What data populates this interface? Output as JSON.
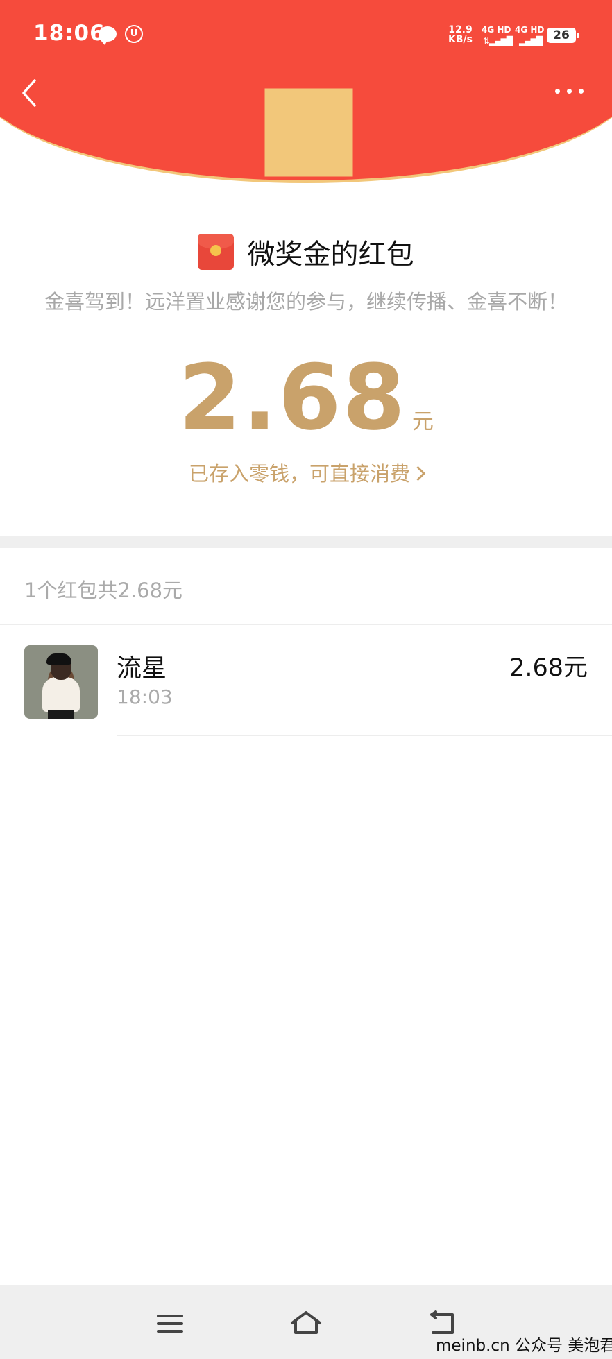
{
  "status_bar": {
    "time": "18:06",
    "speed_value": "12.9",
    "speed_unit": "KB/s",
    "network_1": "4G HD",
    "network_2": "4G HD",
    "battery": "26"
  },
  "header": {
    "back_icon": "chevron-left-icon",
    "more_icon": "more-dots-icon",
    "accent_color": "#f64b3c",
    "border_color": "#f2c77a"
  },
  "packet": {
    "icon": "red-envelope-icon",
    "title": "微奖金的红包",
    "blessing": "金喜驾到！远洋置业感谢您的参与，继续传播、金喜不断！",
    "amount": "2.68",
    "unit": "元",
    "deposit_text": "已存入零钱，可直接消费",
    "gold_color": "#c9a26b"
  },
  "summary": "1个红包共2.68元",
  "records": [
    {
      "name": "流星",
      "time": "18:03",
      "amount": "2.68元",
      "avatar": "avatar-image"
    }
  ],
  "nav_bar": {
    "menu_icon": "menu-icon",
    "home_icon": "home-icon",
    "back_icon": "back-icon"
  },
  "watermark": "meinb.cn  公众号 美泡君"
}
